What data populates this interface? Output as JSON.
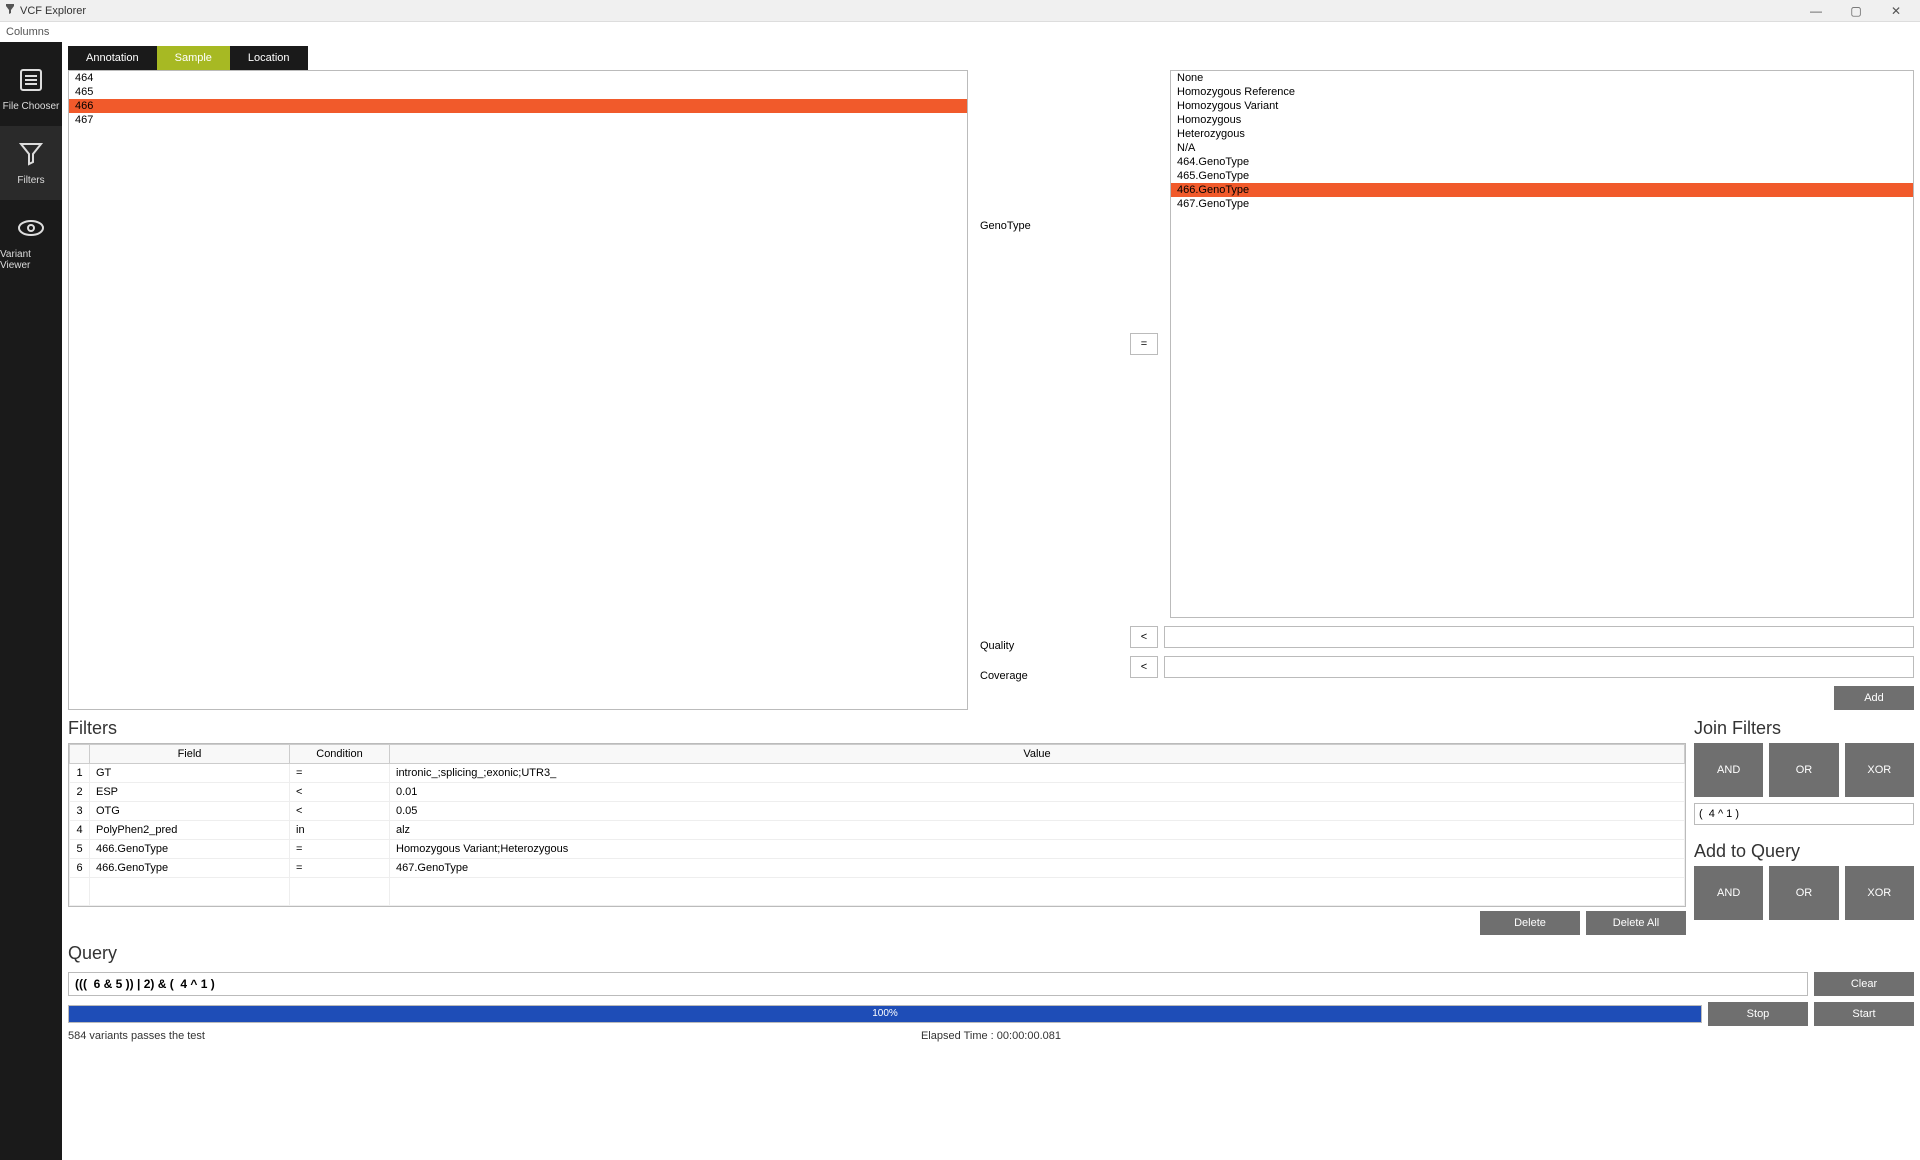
{
  "window": {
    "title": "VCF Explorer",
    "menu": "Columns"
  },
  "sidebar": {
    "items": [
      {
        "label": "File Chooser"
      },
      {
        "label": "Filters"
      },
      {
        "label": "Variant Viewer"
      }
    ]
  },
  "tabs": {
    "items": [
      "Annotation",
      "Sample",
      "Location"
    ],
    "active": 1
  },
  "samples": {
    "items": [
      "464",
      "465",
      "466",
      "467"
    ],
    "selected": 2
  },
  "genotype": {
    "label": "GenoType",
    "operator": "=",
    "values": [
      "None",
      "Homozygous Reference",
      "Homozygous Variant",
      "Homozygous",
      "Heterozygous",
      "N/A",
      "464.GenoType",
      "465.GenoType",
      "466.GenoType",
      "467.GenoType"
    ],
    "selected": 8
  },
  "quality": {
    "label": "Quality",
    "operator": "<",
    "value": ""
  },
  "coverage": {
    "label": "Coverage",
    "operator": "<",
    "value": ""
  },
  "add_label": "Add",
  "filters": {
    "title": "Filters",
    "headers": {
      "field": "Field",
      "condition": "Condition",
      "value": "Value"
    },
    "rows": [
      {
        "n": "1",
        "field": "GT",
        "cond": "=",
        "value": "intronic_;splicing_;exonic;UTR3_"
      },
      {
        "n": "2",
        "field": "ESP",
        "cond": "<",
        "value": "0.01"
      },
      {
        "n": "3",
        "field": "OTG",
        "cond": "<",
        "value": "0.05"
      },
      {
        "n": "4",
        "field": "PolyPhen2_pred",
        "cond": "in",
        "value": "alz"
      },
      {
        "n": "5",
        "field": "466.GenoType",
        "cond": "=",
        "value": "Homozygous Variant;Heterozygous"
      },
      {
        "n": "6",
        "field": "466.GenoType",
        "cond": "=",
        "value": "467.GenoType"
      }
    ],
    "delete": "Delete",
    "delete_all": "Delete All"
  },
  "join": {
    "title": "Join Filters",
    "and": "AND",
    "or": "OR",
    "xor": "XOR",
    "value": "(  4 ^ 1 )"
  },
  "addq": {
    "title": "Add to Query",
    "and": "AND",
    "or": "OR",
    "xor": "XOR"
  },
  "query": {
    "title": "Query",
    "value": "(((  6 & 5 )) | 2) & (  4 ^ 1 )",
    "clear": "Clear"
  },
  "progress": {
    "percent": "100%",
    "width": "100%",
    "stop": "Stop",
    "start": "Start"
  },
  "status": {
    "left": "584 variants passes the test",
    "center": "Elapsed Time : 00:00:00.081"
  }
}
